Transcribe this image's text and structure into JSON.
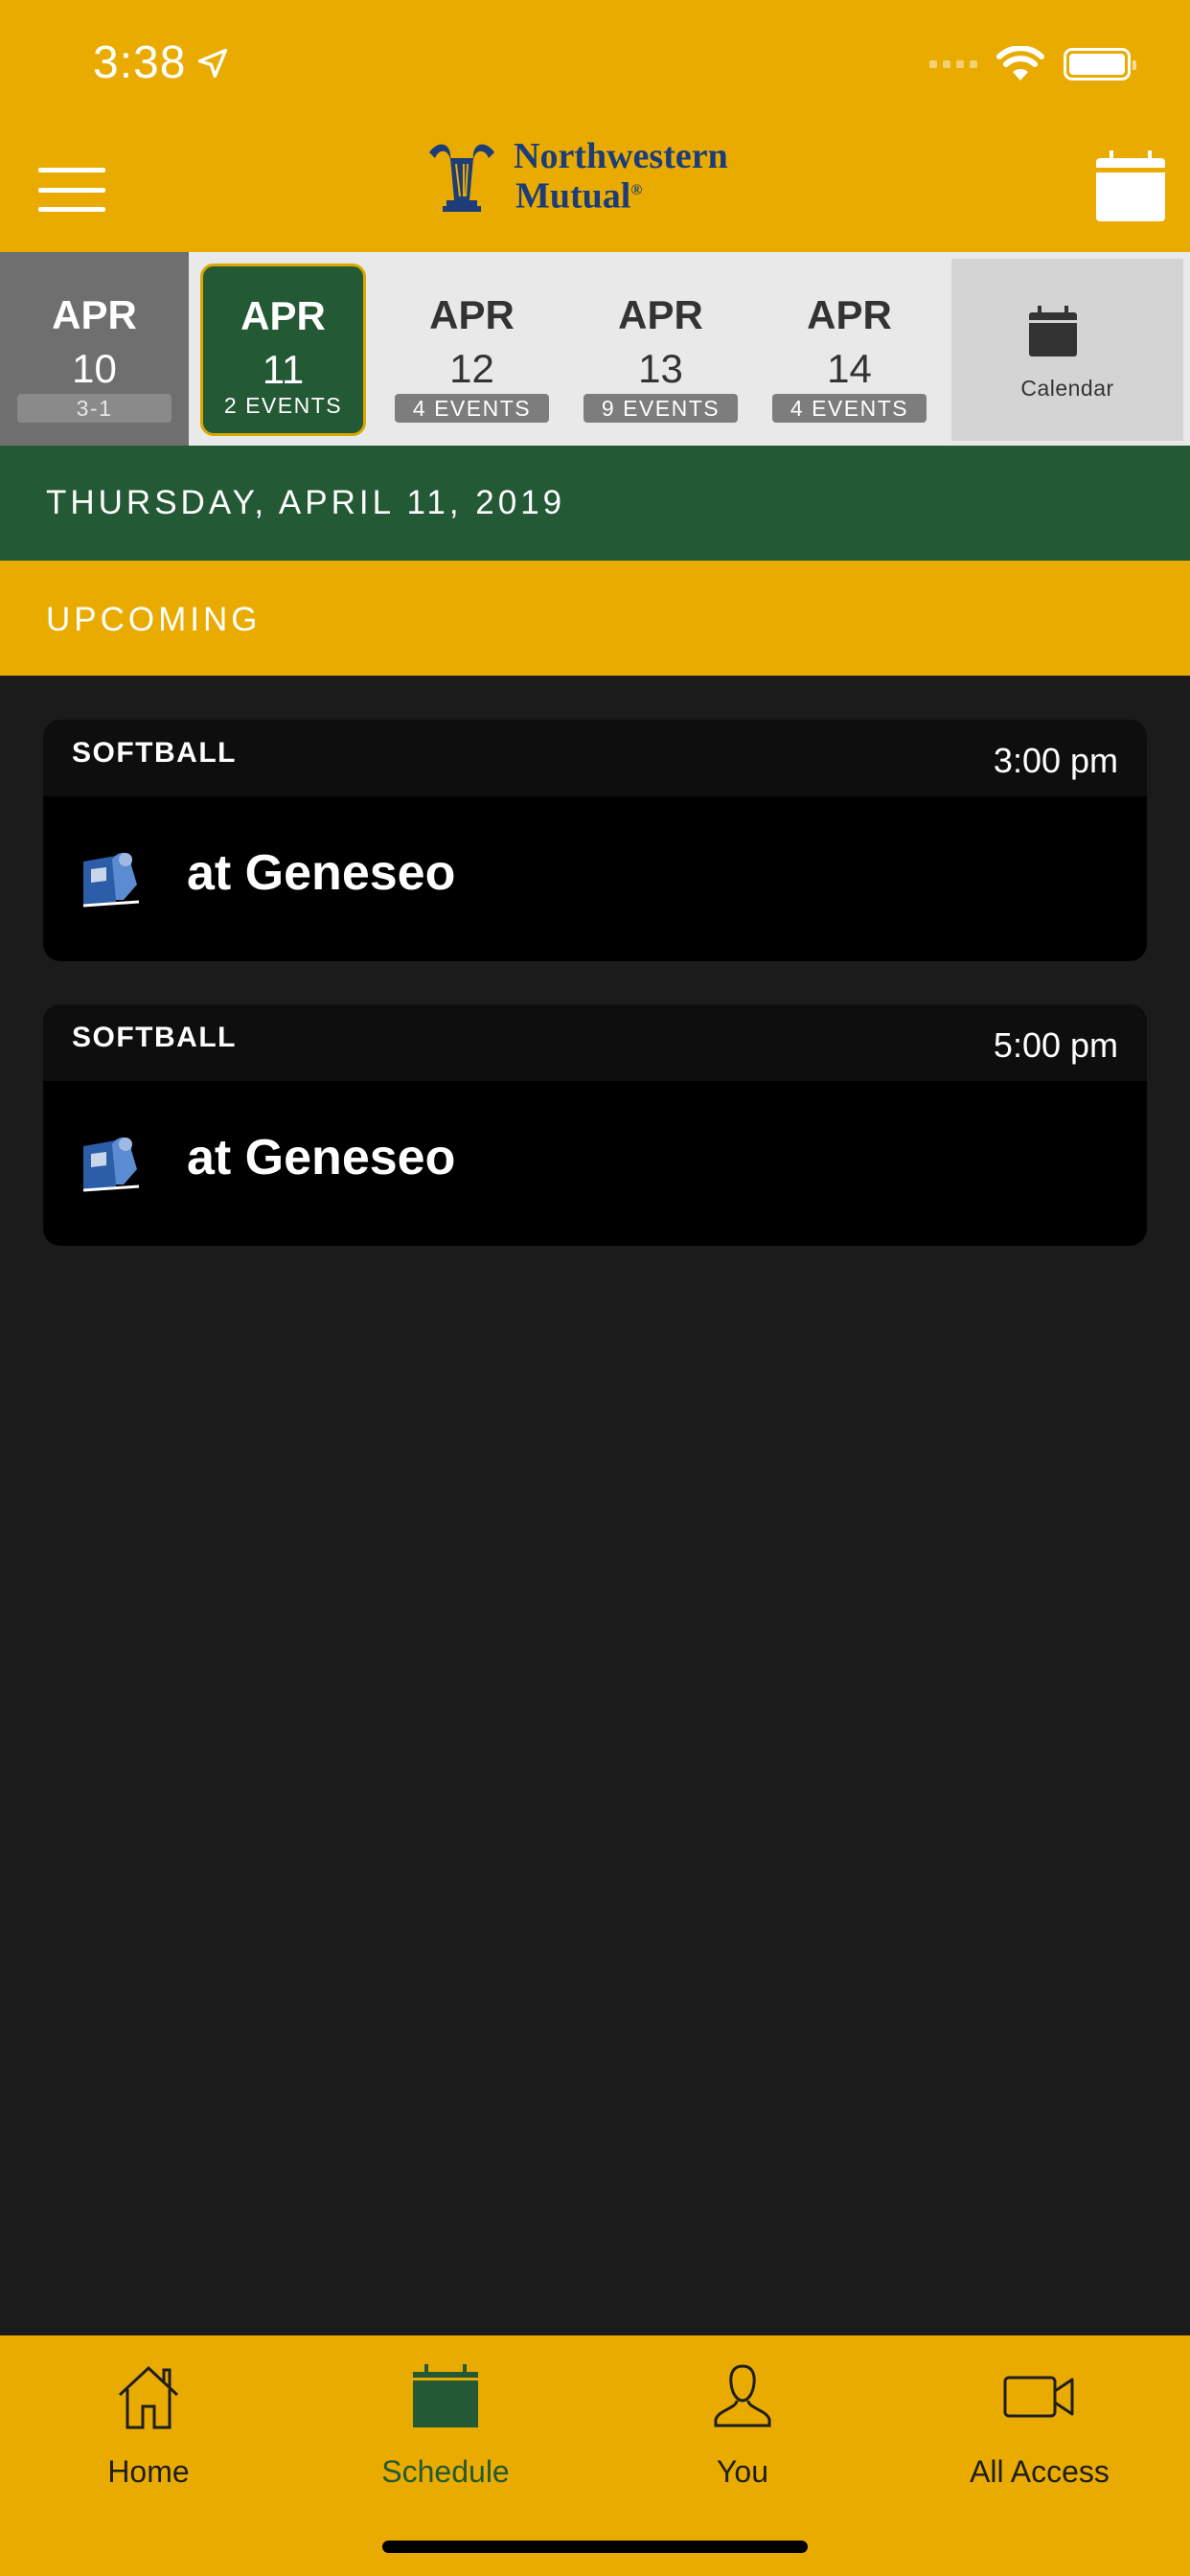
{
  "status_bar": {
    "time": "3:38"
  },
  "header": {
    "logo_line1": "Northwestern",
    "logo_line2": "Mutual",
    "logo_reg": "®"
  },
  "date_strip": {
    "days": [
      {
        "month": "APR",
        "day": "10",
        "badge": "3-1",
        "state": "past"
      },
      {
        "month": "APR",
        "day": "11",
        "badge": "2 EVENTS",
        "state": "selected"
      },
      {
        "month": "APR",
        "day": "12",
        "badge": "4 EVENTS",
        "state": "future"
      },
      {
        "month": "APR",
        "day": "13",
        "badge": "9 EVENTS",
        "state": "future"
      },
      {
        "month": "APR",
        "day": "14",
        "badge": "4 EVENTS",
        "state": "future"
      }
    ],
    "calendar_label": "Calendar"
  },
  "day_header": "THURSDAY, APRIL 11, 2019",
  "section_label": "UPCOMING",
  "events": [
    {
      "sport": "SOFTBALL",
      "time": "3:00 pm",
      "opponent": "at Geneseo"
    },
    {
      "sport": "SOFTBALL",
      "time": "5:00 pm",
      "opponent": "at Geneseo"
    }
  ],
  "tabs": [
    {
      "label": "Home",
      "icon": "home-icon"
    },
    {
      "label": "Schedule",
      "icon": "calendar-icon",
      "active": true
    },
    {
      "label": "You",
      "icon": "person-icon"
    },
    {
      "label": "All Access",
      "icon": "video-camera-icon"
    }
  ],
  "colors": {
    "brand_gold": "#eaab00",
    "brand_green": "#235934",
    "background": "#1b1b1b"
  }
}
